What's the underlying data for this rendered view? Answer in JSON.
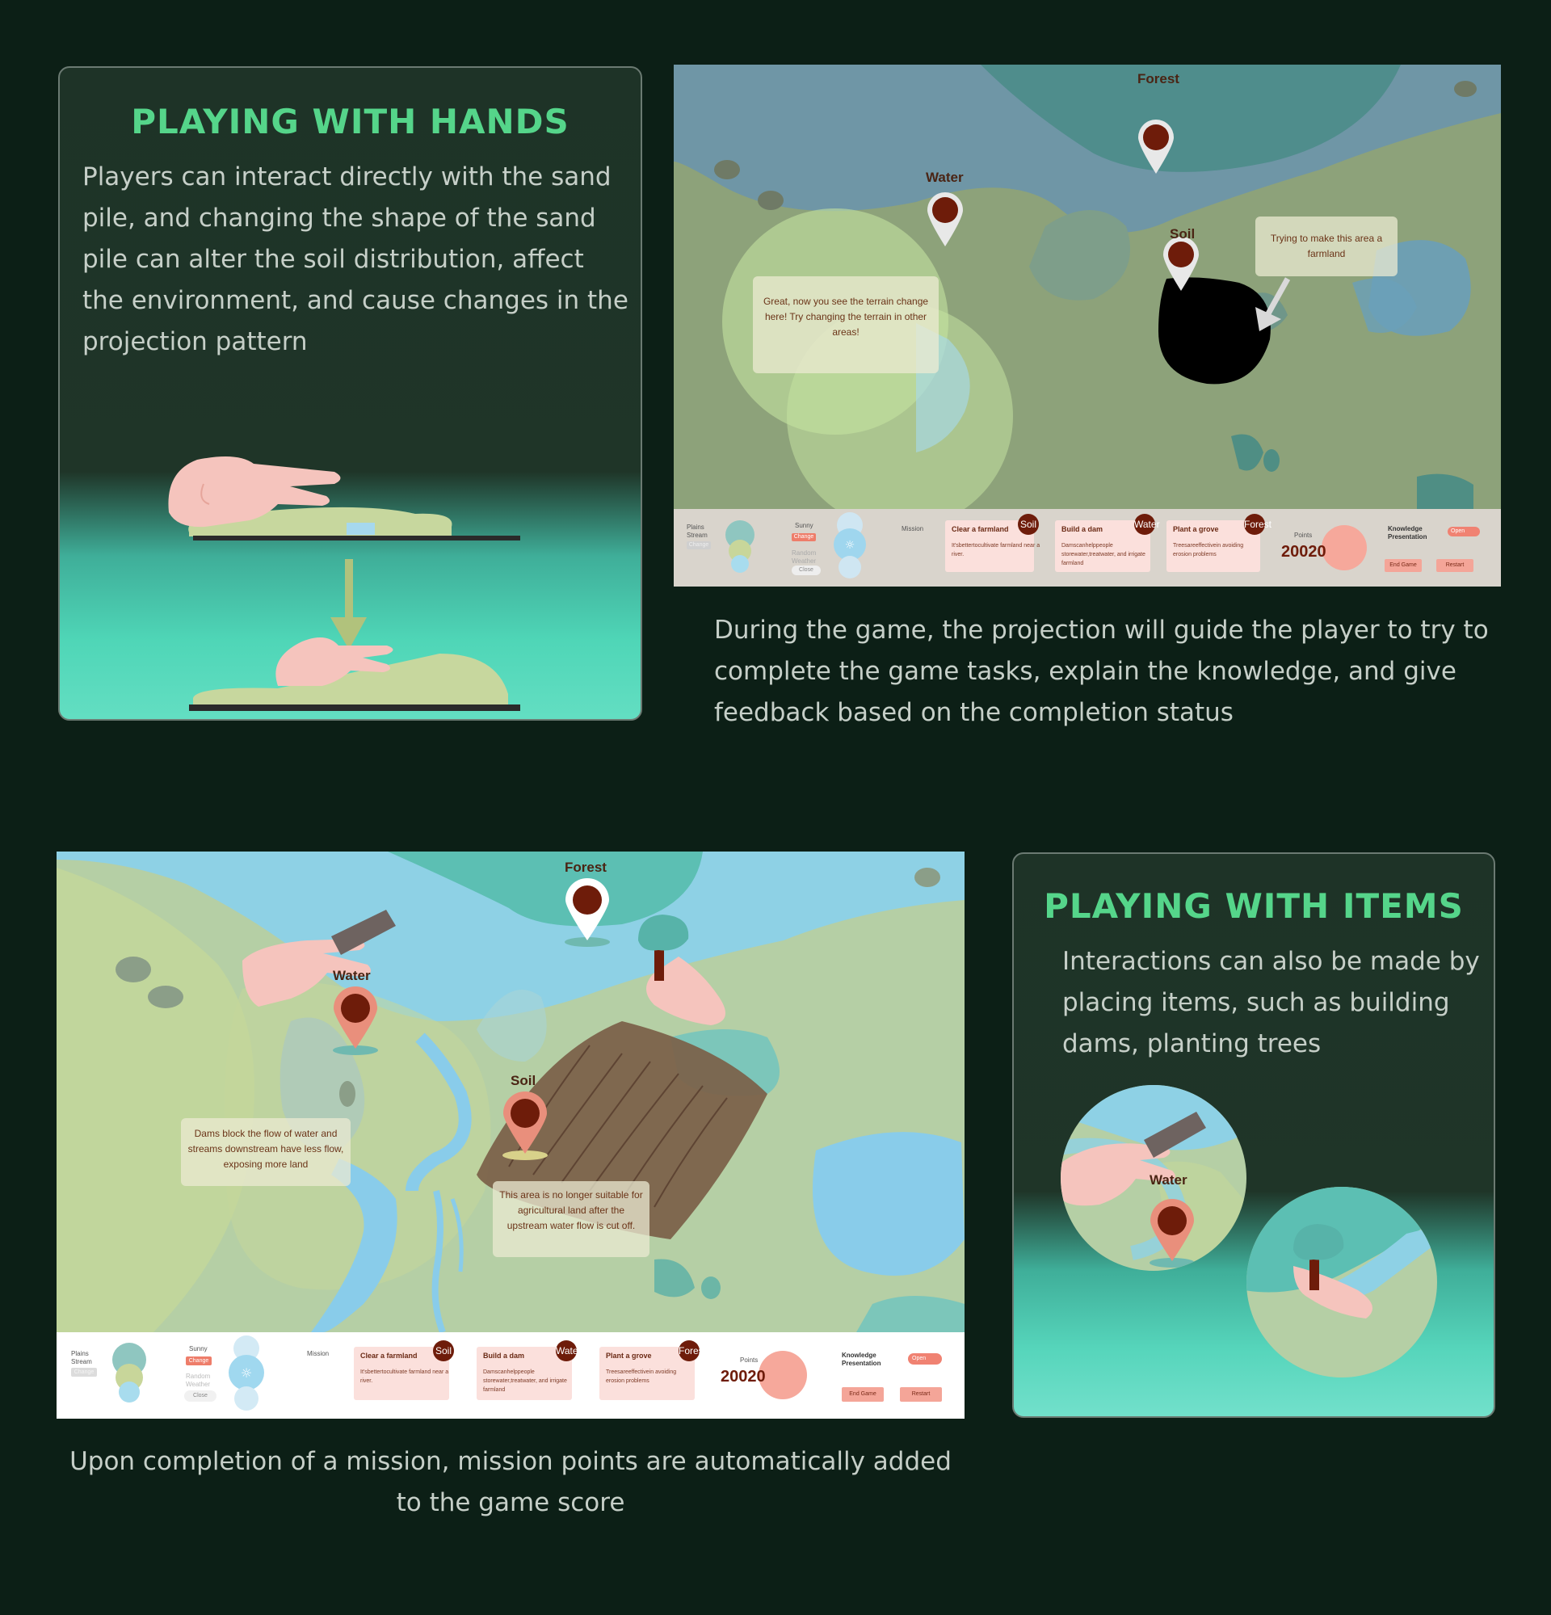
{
  "hands_card": {
    "title": "PLAYING WITH HANDS",
    "body": "Players can interact directly with the sand pile, and changing the shape of the sand pile can alter the soil distribution, affect the environment, and cause changes in the projection pattern"
  },
  "items_card": {
    "title": "PLAYING WITH ITEMS",
    "body": "Interactions can also be made by placing items, such as building dams, planting trees",
    "zoom_pin_label": "Water"
  },
  "caption_top": "During the game, the projection will guide the player to try to complete  the game tasks, explain the knowledge, and give feedback based on the completion status",
  "caption_bottom": "Upon completion of a mission, mission points are automatically added to the game score",
  "screenshot1": {
    "pins": {
      "forest": "Forest",
      "water": "Water",
      "soil": "Soil"
    },
    "note_left": "Great, now you see the terrain change here! Try changing the terrain in other areas!",
    "note_right": "Trying to make this area a farmland"
  },
  "screenshot2": {
    "pins": {
      "forest": "Forest",
      "water": "Water",
      "soil": "Soil"
    },
    "note_left": "Dams block the flow of water and streams downstream have less flow, exposing more land",
    "note_right": "This area is no longer suitable for agricultural land after the upstream water flow is cut off."
  },
  "hud": {
    "terrain_label": "Plains Stream",
    "terrain_change": "Change",
    "weather_label": "Sunny",
    "weather_change": "Change",
    "random_weather": "Random Weather",
    "close": "Close",
    "mission_label": "Mission",
    "missions": [
      {
        "title": "Clear a farmland",
        "desc": "It'sbettertocultivate farmland near a river.",
        "badge": "Soil"
      },
      {
        "title": "Build a dam",
        "desc": "Damscanhelppeople storewater,treatwater, and irrigate farmland",
        "badge": "Water"
      },
      {
        "title": "Plant a grove",
        "desc": "Treesareeffectivein avoiding erosion problems",
        "badge": "Forest"
      }
    ],
    "points_label": "Points",
    "points": "20020",
    "knowledge_label": "Knowledge Presentation",
    "toggle": "Open",
    "end_game": "End Game",
    "restart": "Restart"
  }
}
